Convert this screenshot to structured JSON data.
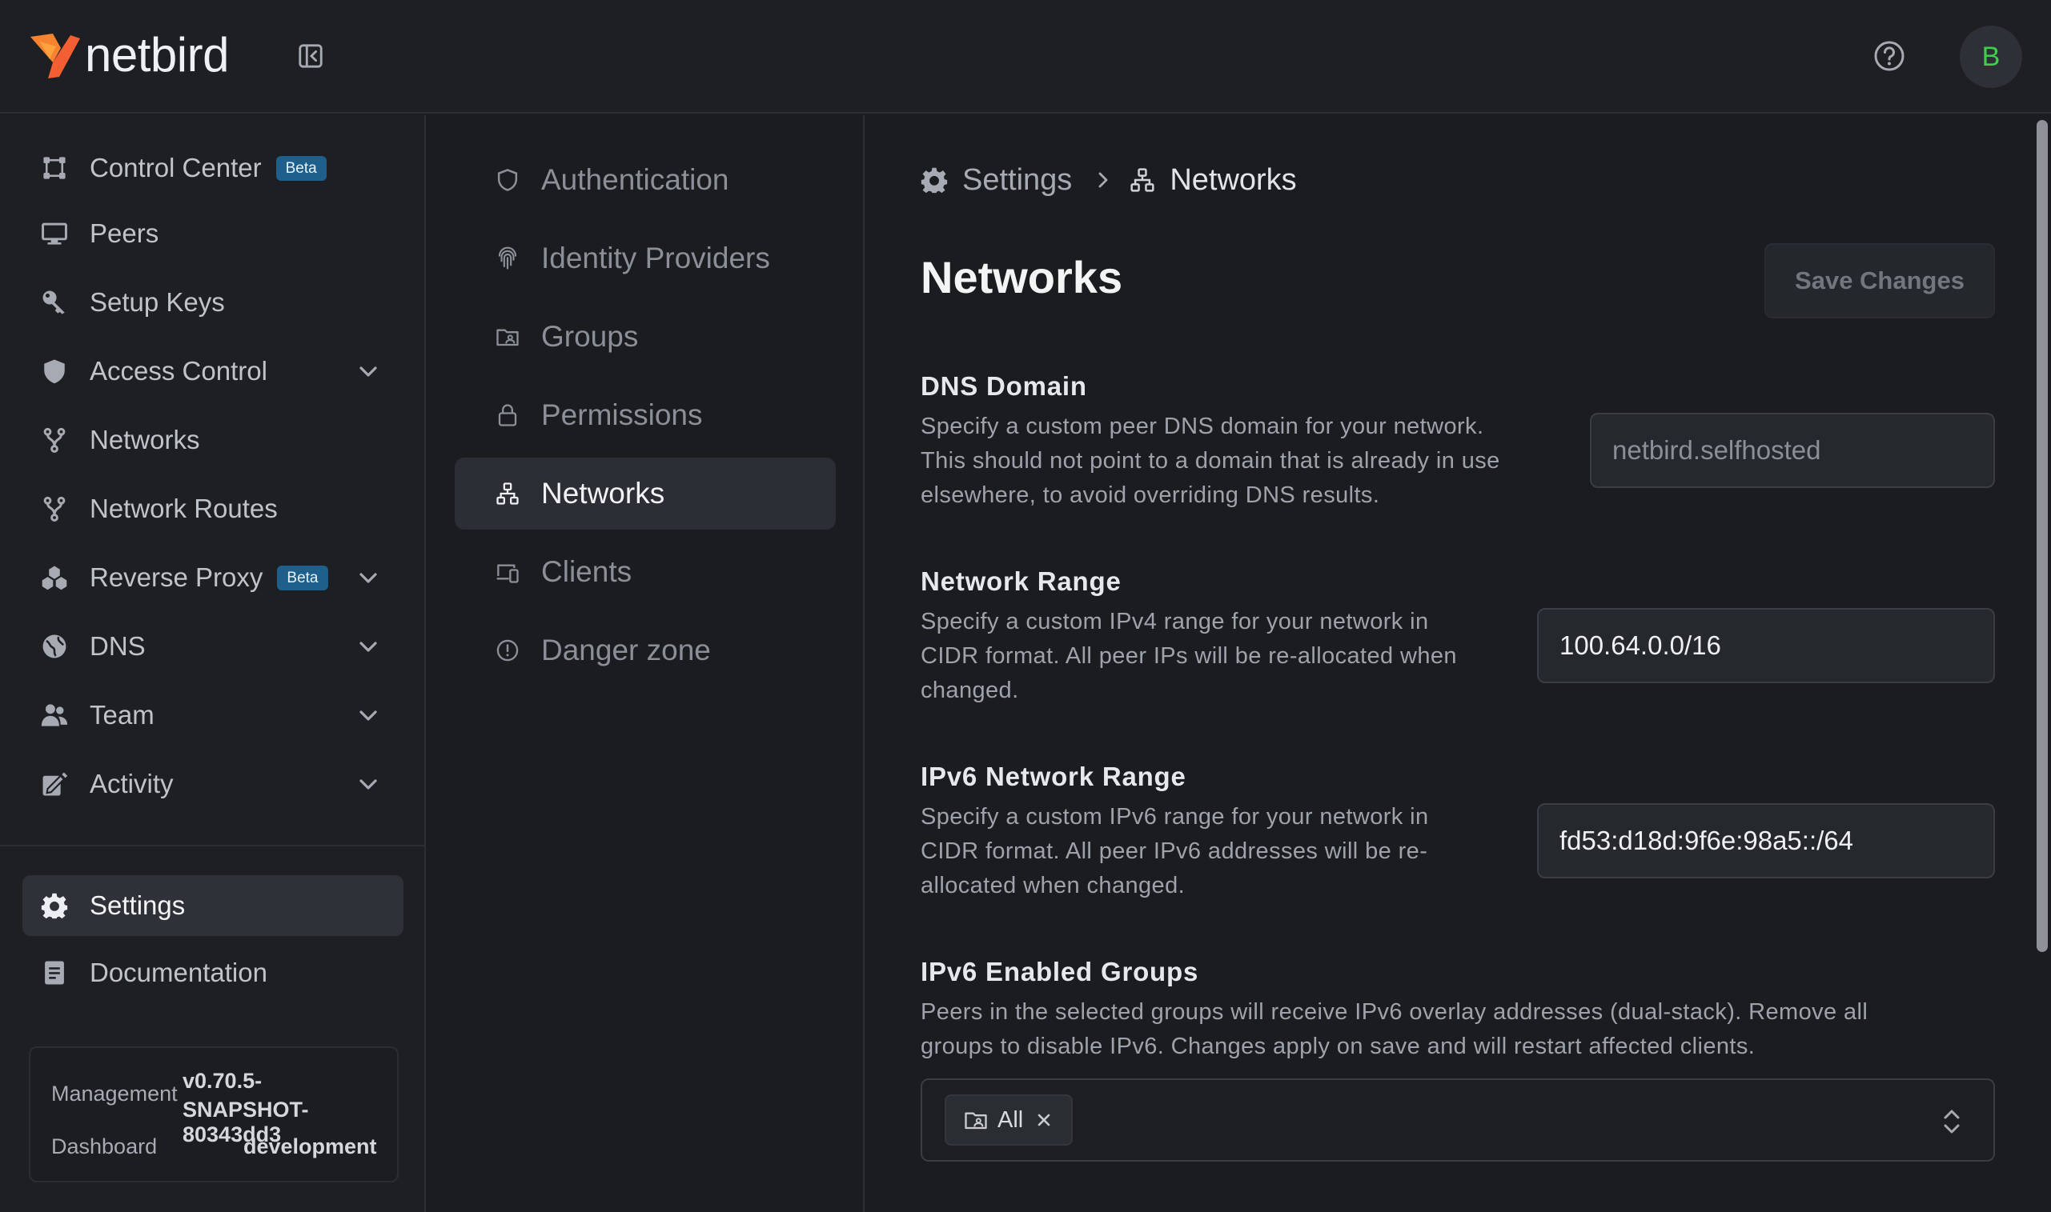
{
  "app": {
    "logo_text": "netbird",
    "avatar_initial": "B"
  },
  "sidebar": {
    "items": [
      {
        "label": "Control Center",
        "icon": "control-center-icon",
        "badge": "Beta"
      },
      {
        "label": "Peers",
        "icon": "monitor-icon"
      },
      {
        "label": "Setup Keys",
        "icon": "key-icon"
      },
      {
        "label": "Access Control",
        "icon": "shield-icon",
        "expandable": true
      },
      {
        "label": "Networks",
        "icon": "network-fork-icon"
      },
      {
        "label": "Network Routes",
        "icon": "network-fork-icon"
      },
      {
        "label": "Reverse Proxy",
        "icon": "reverse-proxy-icon",
        "badge": "Beta",
        "expandable": true
      },
      {
        "label": "DNS",
        "icon": "globe-icon",
        "expandable": true
      },
      {
        "label": "Team",
        "icon": "users-icon",
        "expandable": true
      },
      {
        "label": "Activity",
        "icon": "activity-icon",
        "expandable": true
      }
    ],
    "bottom": [
      {
        "label": "Settings",
        "icon": "gear-icon",
        "active": true
      },
      {
        "label": "Documentation",
        "icon": "document-icon"
      }
    ],
    "version": {
      "management_label": "Management",
      "management_value_line1": "v0.70.5-",
      "management_value_line2": "SNAPSHOT-80343dd3",
      "dashboard_label": "Dashboard",
      "dashboard_value": "development"
    }
  },
  "settings_nav": {
    "items": [
      {
        "label": "Authentication",
        "icon": "shield-outline-icon"
      },
      {
        "label": "Identity Providers",
        "icon": "fingerprint-icon"
      },
      {
        "label": "Groups",
        "icon": "folder-group-icon"
      },
      {
        "label": "Permissions",
        "icon": "lock-icon"
      },
      {
        "label": "Networks",
        "icon": "network-icon",
        "active": true
      },
      {
        "label": "Clients",
        "icon": "devices-icon"
      },
      {
        "label": "Danger zone",
        "icon": "alert-circle-icon"
      }
    ]
  },
  "main": {
    "breadcrumb": {
      "root": "Settings",
      "current": "Networks"
    },
    "title": "Networks",
    "save_label": "Save Changes",
    "dns_domain": {
      "title": "DNS Domain",
      "desc_1": "Specify a custom peer DNS domain for your network.",
      "desc_2": "This should not point to a domain that is already in use",
      "desc_3": "elsewhere, to avoid overriding DNS results.",
      "placeholder": "netbird.selfhosted"
    },
    "network_range": {
      "title": "Network Range",
      "desc_1": "Specify a custom IPv4 range for your network in",
      "desc_2": "CIDR format. All peer IPs will be re-allocated when",
      "desc_3": "changed.",
      "value": "100.64.0.0/16"
    },
    "ipv6_range": {
      "title": "IPv6 Network Range",
      "desc_1": "Specify a custom IPv6 range for your network in",
      "desc_2": "CIDR format. All peer IPv6 addresses will be re-",
      "desc_3": "allocated when changed.",
      "value": "fd53:d18d:9f6e:98a5::/64"
    },
    "ipv6_groups": {
      "title": "IPv6 Enabled Groups",
      "desc_1": "Peers in the selected groups will receive IPv6 overlay addresses (dual-stack). Remove all",
      "desc_2": "groups to disable IPv6. Changes apply on save and will restart affected clients.",
      "selected": [
        "All"
      ]
    }
  },
  "colors": {
    "accent_orange": "#f68330",
    "badge_blue": "#1f5f8c",
    "avatar_green": "#3fcf4b"
  }
}
